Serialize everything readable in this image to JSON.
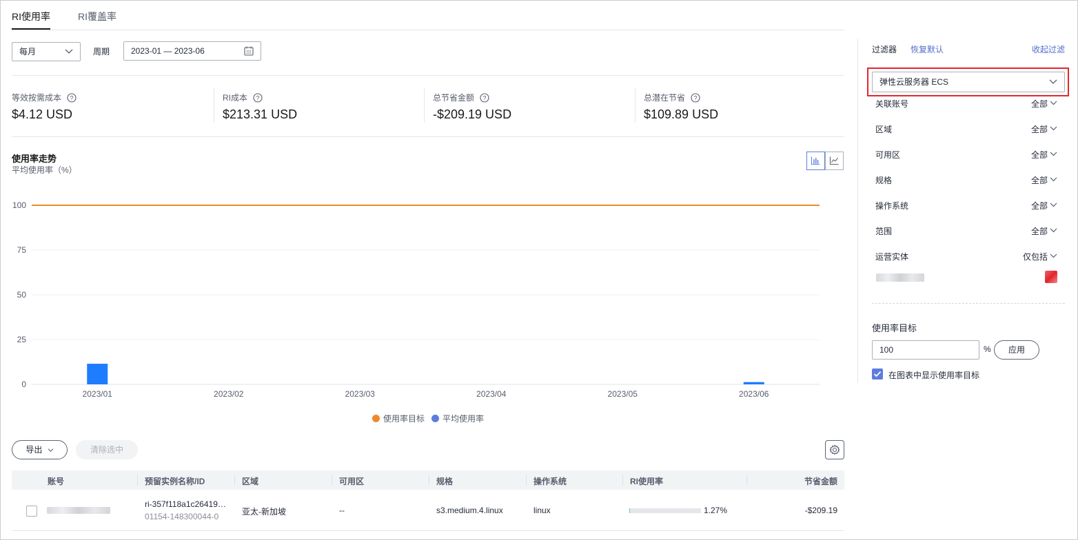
{
  "tabs": [
    {
      "label": "RI使用率",
      "active": true
    },
    {
      "label": "RI覆盖率",
      "active": false
    }
  ],
  "controls": {
    "granularity": "每月",
    "period_label": "周期",
    "period_value": "2023-01 — 2023-06"
  },
  "metrics": [
    {
      "title": "等效按需成本",
      "value": "$4.12 USD"
    },
    {
      "title": "RI成本",
      "value": "$213.31 USD"
    },
    {
      "title": "总节省金额",
      "value": "-$209.19 USD"
    },
    {
      "title": "总潜在节省",
      "value": "$109.89 USD"
    }
  ],
  "chart": {
    "title": "使用率走势",
    "subtitle": "平均使用率（%）",
    "legend_target": "使用率目标",
    "legend_avg": "平均使用率"
  },
  "chart_data": {
    "type": "bar",
    "categories": [
      "2023/01",
      "2023/02",
      "2023/03",
      "2023/04",
      "2023/05",
      "2023/06"
    ],
    "series": [
      {
        "name": "平均使用率",
        "values": [
          11.5,
          0,
          0,
          0,
          0,
          1.27
        ],
        "color": "#1e7cff"
      },
      {
        "name": "使用率目标",
        "type": "line",
        "values": [
          100,
          100,
          100,
          100,
          100,
          100
        ],
        "color": "#f0882c"
      }
    ],
    "yticks": [
      "0",
      "25",
      "50",
      "75",
      "100"
    ],
    "ylim": [
      0,
      100
    ],
    "grid": true,
    "legend": "bottom-center"
  },
  "toolbar": {
    "export_label": "导出",
    "clear_label": "清除选中"
  },
  "table": {
    "columns": [
      "账号",
      "预留实例名称/ID",
      "区域",
      "可用区",
      "规格",
      "操作系统",
      "RI使用率",
      "节省金额"
    ],
    "rows": [
      {
        "ri_name": "ri-357f118a1c26419…",
        "ri_id": "01154-148300044-0",
        "region": "亚太-新加坡",
        "az": "--",
        "flavor": "s3.medium.4.linux",
        "os": "linux",
        "usage": "1.27%",
        "usage_fraction": 0.0127,
        "savings": "-$209.19"
      }
    ]
  },
  "filters": {
    "title": "过滤器",
    "reset": "恢复默认",
    "collapse": "收起过滤",
    "service": "弹性云服务器 ECS",
    "items": [
      {
        "label": "关联账号",
        "value": "全部"
      },
      {
        "label": "区域",
        "value": "全部"
      },
      {
        "label": "可用区",
        "value": "全部"
      },
      {
        "label": "规格",
        "value": "全部"
      },
      {
        "label": "操作系统",
        "value": "全部"
      },
      {
        "label": "范围",
        "value": "全部"
      },
      {
        "label": "运营实体",
        "value": "仅包括"
      }
    ],
    "target_title": "使用率目标",
    "target_value": "100",
    "target_unit": "%",
    "apply_label": "应用",
    "show_target_label": "在图表中显示使用率目标"
  },
  "colors": {
    "accent": "#5e7ce0",
    "bar": "#1e7cff",
    "target_line": "#f0882c",
    "highlight": "#e5242b",
    "progress": "#50d4ab"
  }
}
